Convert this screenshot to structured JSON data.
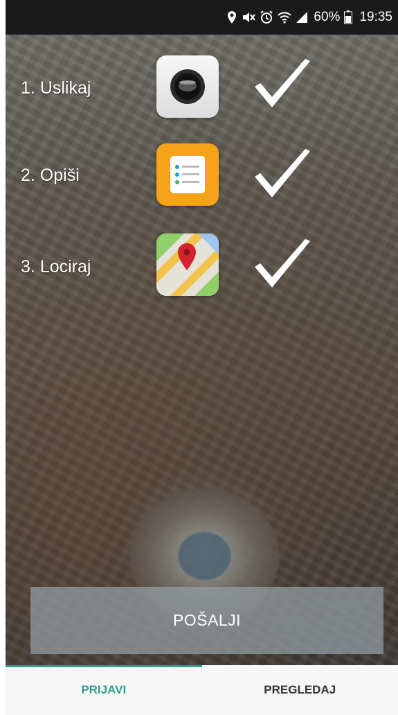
{
  "status_bar": {
    "icons": [
      "location-icon",
      "mute-icon",
      "alarm-icon",
      "wifi-icon",
      "signal-icon"
    ],
    "battery": "60%",
    "time": "19:35"
  },
  "steps": [
    {
      "label": "1. Uslikaj",
      "icon": "camera-icon",
      "done": true
    },
    {
      "label": "2. Opiši",
      "icon": "notes-icon",
      "done": true
    },
    {
      "label": "3. Lociraj",
      "icon": "map-icon",
      "done": true
    }
  ],
  "send_button": {
    "label": "POŠALJI"
  },
  "tabs": [
    {
      "label": "PRIJAVI",
      "active": true
    },
    {
      "label": "PREGLEDAJ",
      "active": false
    }
  ],
  "colors": {
    "accent": "#2e9e88",
    "status_bar": "#1a1a1a",
    "tab_bg": "#f6f6f6"
  }
}
